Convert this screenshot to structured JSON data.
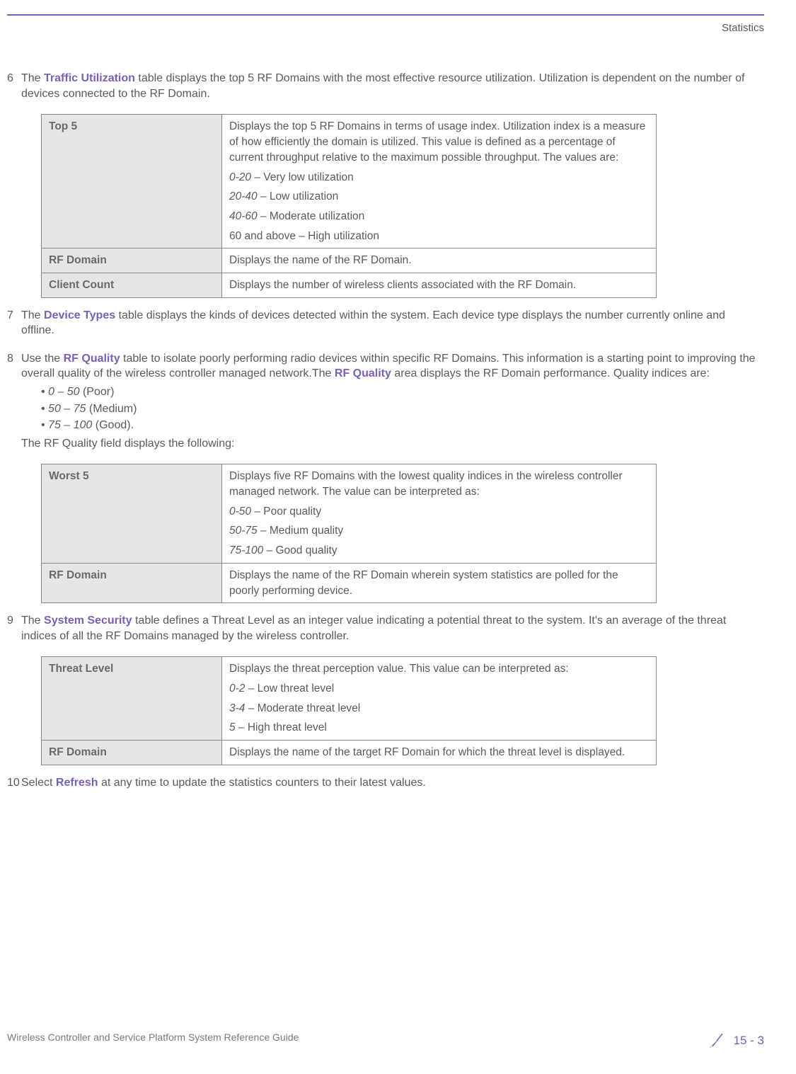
{
  "header": {
    "breadcrumb": "Statistics"
  },
  "steps": [
    {
      "num": "6",
      "intro_parts": [
        "The ",
        "Traffic Utilization",
        " table displays the top 5 RF Domains with the most effective resource utilization. Utilization is dependent on the number of devices connected to the RF Domain."
      ],
      "table": [
        {
          "label": "Top 5",
          "lines": [
            "Displays the top 5 RF Domains in terms of usage index. Utilization index is a measure of how efficiently the domain is utilized. This value is defined as a percentage of current throughput relative to the maximum possible throughput. The values are:",
            {
              "i": "0-20",
              "r": " – Very low utilization"
            },
            {
              "i": "20-40",
              "r": " – Low utilization"
            },
            {
              "i": "40-60",
              "r": " – Moderate utilization"
            },
            "60 and above – High utilization"
          ]
        },
        {
          "label": "RF Domain",
          "lines": [
            "Displays the name of the RF Domain."
          ]
        },
        {
          "label": "Client Count",
          "lines": [
            "Displays the number of wireless clients associated with the RF Domain."
          ]
        }
      ]
    },
    {
      "num": "7",
      "intro_parts": [
        "The ",
        "Device Types",
        " table displays the kinds of devices detected within the system. Each device type displays the number currently online and offline."
      ]
    },
    {
      "num": "8",
      "intro_parts": [
        "Use the ",
        "RF Quality",
        " table to isolate poorly performing radio devices within specific RF Domains. This information is a starting point to improving the overall quality of the wireless controller managed network.The ",
        "RF Quality",
        " area displays the RF Domain performance. Quality indices are:"
      ],
      "bullets": [
        {
          "i": "0 – 50",
          "r": " (Poor)"
        },
        {
          "i": "50 – 75",
          "r": " (Medium)"
        },
        {
          "i": "75 – 100",
          "r": " (Good)."
        }
      ],
      "post_bullets": "The RF Quality field displays the following:",
      "table": [
        {
          "label": "Worst 5",
          "lines": [
            "Displays five RF Domains with the lowest quality indices in the wireless controller managed network. The value can be interpreted as:",
            {
              "i": "0-50",
              "r": " – Poor quality"
            },
            {
              "i": "50-75",
              "r": " – Medium quality"
            },
            {
              "i": "75-100",
              "r": " – Good quality"
            }
          ]
        },
        {
          "label": "RF Domain",
          "lines": [
            "Displays the name of the RF Domain wherein system statistics are polled for the poorly performing device."
          ]
        }
      ]
    },
    {
      "num": "9",
      "intro_parts": [
        "The ",
        "System Security",
        " table defines a Threat Level as an integer value indicating a potential threat to the system. It's an average of the threat indices of all the RF Domains managed by the wireless controller."
      ],
      "table": [
        {
          "label": "Threat Level",
          "lines": [
            "Displays the threat perception value. This value can be interpreted as:",
            {
              "i": "0-2",
              "r": " – Low threat level"
            },
            {
              "i": "3-4",
              "r": " – Moderate threat level"
            },
            {
              "i": "5",
              "r": " – High threat level"
            }
          ]
        },
        {
          "label": "RF Domain",
          "lines": [
            "Displays the name of the target RF Domain for which the threat level is displayed."
          ]
        }
      ]
    },
    {
      "num": "10",
      "intro_parts": [
        "Select ",
        "Refresh",
        " at any time to update the statistics counters to their latest values."
      ]
    }
  ],
  "footer": {
    "left": "Wireless Controller and Service Platform System Reference Guide",
    "right": "15 - 3"
  }
}
